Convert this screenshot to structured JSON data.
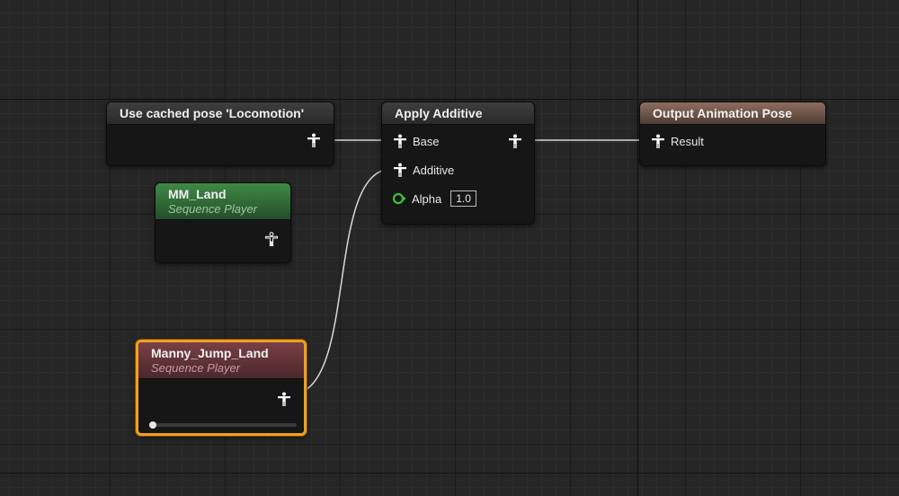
{
  "nodes": {
    "cached_pose": {
      "title": "Use cached pose 'Locomotion'",
      "output_pin_icon": "pose-icon"
    },
    "apply_additive": {
      "title": "Apply Additive",
      "pins": {
        "base_label": "Base",
        "additive_label": "Additive",
        "alpha_label": "Alpha",
        "alpha_value": "1.0"
      }
    },
    "output_pose": {
      "title": "Output Animation Pose",
      "pins": {
        "result_label": "Result"
      }
    },
    "mm_land": {
      "title": "MM_Land",
      "subtitle": "Sequence Player"
    },
    "manny_jump_land": {
      "title": "Manny_Jump_Land",
      "subtitle": "Sequence Player",
      "playback_progress": 0.0
    }
  },
  "colors": {
    "selection_outline": "#f0a020",
    "alpha_pin": "#3cbf3c",
    "header_gray": "#3e3e3e",
    "header_green": "#3f8a46",
    "header_red": "#7a3f46",
    "header_tan": "#8d6e5e"
  }
}
